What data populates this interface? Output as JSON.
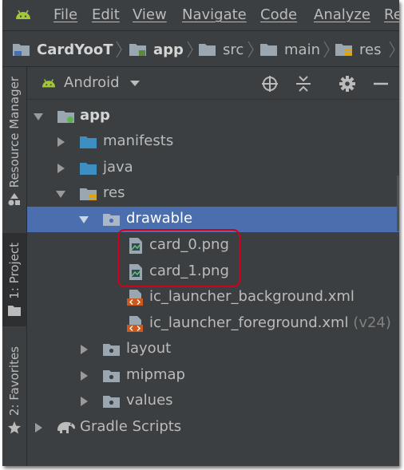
{
  "menu": {
    "items": [
      "File",
      "Edit",
      "View",
      "Navigate",
      "Code",
      "Analyze",
      "Re"
    ]
  },
  "breadcrumb": {
    "items": [
      "CardYooT",
      "app",
      "src",
      "main",
      "res"
    ]
  },
  "tool_strip": {
    "resource_manager": "Resource Manager",
    "project": "1: Project",
    "favorites": "2: Favorites"
  },
  "project_view": {
    "selector": "Android",
    "icons": [
      "crosshair-icon",
      "collapse-icon",
      "gear-icon",
      "minimize-icon"
    ]
  },
  "tree": {
    "app": "app",
    "manifests": "manifests",
    "java": "java",
    "res": "res",
    "drawable": "drawable",
    "card_0": "card_0.png",
    "card_1": "card_1.png",
    "ic_bg": "ic_launcher_background.xml",
    "ic_fg": "ic_launcher_foreground.xml",
    "ic_fg_hint": "(v24)",
    "layout": "layout",
    "mipmap": "mipmap",
    "values": "values",
    "gradle": "Gradle Scripts"
  },
  "colors": {
    "background": "#3c3f41",
    "selection": "#4b6eaf",
    "folder_blue": "#3d8fc2",
    "highlight_border": "#d0021b",
    "android_green": "#a4c639"
  }
}
